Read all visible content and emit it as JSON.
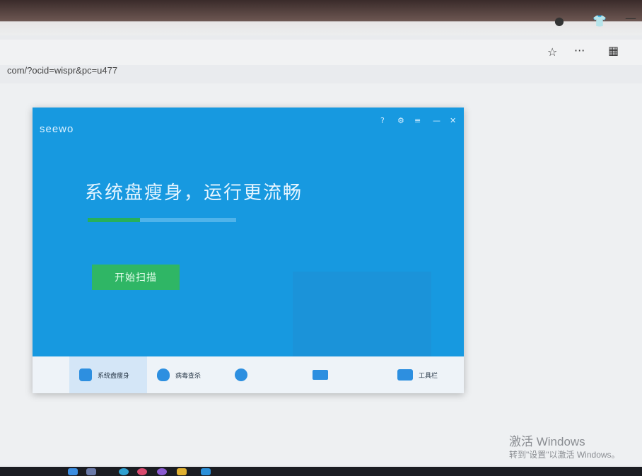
{
  "browser": {
    "url": "com/?ocid=wispr&pc=u477",
    "icons": [
      "profile-icon",
      "shirt-icon",
      "minimize-icon",
      "favorite-star-icon",
      "more-icon",
      "apps-grid-icon"
    ]
  },
  "app": {
    "logo": "seewo",
    "logo_sub": "",
    "org": "",
    "slogan": "系统盘瘦身，运行更流畅",
    "disk": {
      "info": "",
      "used_fraction": 0.35
    },
    "scan_button": "开始扫描",
    "nav": [
      {
        "label": "系统盘瘦身",
        "icon": "disk-slim-icon",
        "active": true
      },
      {
        "label": "病毒查杀",
        "icon": "shield-icon",
        "active": false
      },
      {
        "label": "",
        "icon": "restore-icon",
        "active": false
      },
      {
        "label": "",
        "icon": "popup-block-icon",
        "active": false
      },
      {
        "label": "工具栏",
        "icon": "toolbox-icon",
        "active": false
      }
    ]
  },
  "watermark": {
    "title": "激活 Windows",
    "subtitle": "转到\"设置\"以激活 Windows。"
  },
  "colors": {
    "app_bg": "#1799e0",
    "scan_button": "#2fb665",
    "nav_bg": "#eef3f8"
  }
}
